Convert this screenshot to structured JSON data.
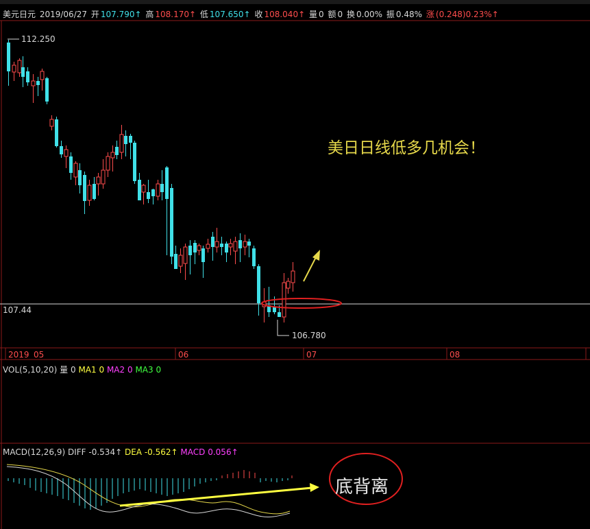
{
  "quote_bar": {
    "symbol": "美元日元",
    "date": "2019/06/27",
    "open_label": "开",
    "open": "107.790↑",
    "high_label": "高",
    "high": "108.170↑",
    "low_label": "低",
    "low": "107.650↑",
    "close_label": "收",
    "close": "108.040↑",
    "volume_label": "量",
    "volume": "0",
    "amount_label": "额",
    "amount": "0",
    "turnover_label": "换",
    "turnover": "0.00%",
    "amplitude_label": "振",
    "amplitude": "0.48%",
    "change_label": "涨",
    "change": "(0.248)0.23%↑"
  },
  "price_panel": {
    "high_mark": "112.250",
    "low_mark": "106.780",
    "crosshair_value": "107.44",
    "annotation": "美日日线低多几机会！",
    "x_labels": [
      "2019",
      "05",
      "06",
      "07",
      "08"
    ]
  },
  "vol_panel": {
    "name": "VOL(5,10,20)",
    "vol_label": "量",
    "vol_value": "0",
    "ma1_label": "MA1",
    "ma1_value": "0",
    "ma2_label": "MA2",
    "ma2_value": "0",
    "ma3_label": "MA3",
    "ma3_value": "0"
  },
  "macd_panel": {
    "name": "MACD(12,26,9)",
    "diff_label": "DIFF",
    "diff_value": "-0.534↑",
    "dea_label": "DEA",
    "dea_value": "-0.562↑",
    "macd_label": "MACD",
    "macd_value": "0.056↑",
    "annotation": "底背离"
  },
  "colors": {
    "up": "#ff4d4d",
    "down": "#40e0e8",
    "grid": "#8b1a1a",
    "annotation_yellow": "#e6d84a",
    "circle_red": "#e02020"
  }
}
